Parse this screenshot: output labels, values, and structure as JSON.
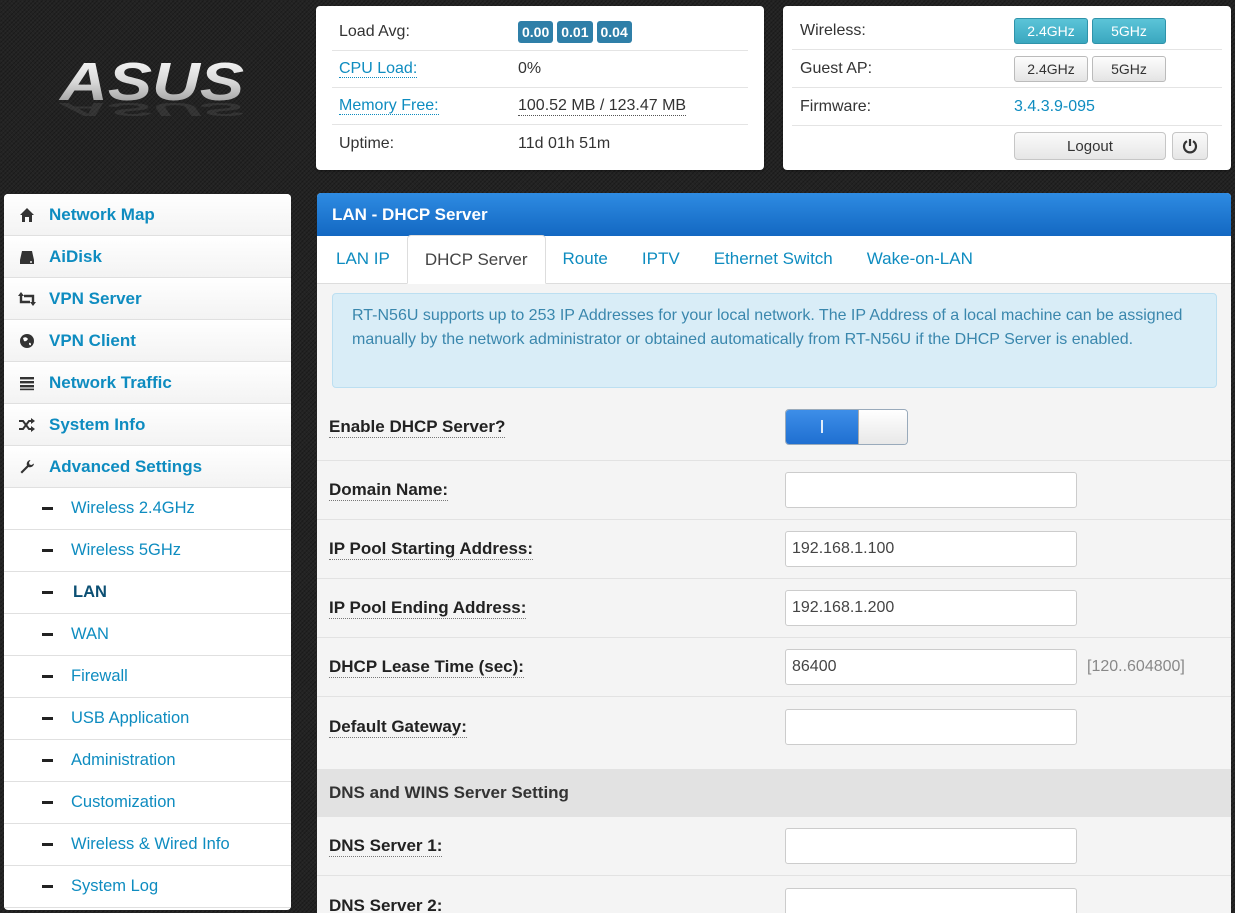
{
  "brand": {
    "logo_text": "ASUS"
  },
  "status": {
    "load_avg_label": "Load Avg:",
    "load_avg_values": [
      "0.00",
      "0.01",
      "0.04"
    ],
    "cpu_label": "CPU Load:",
    "cpu_value": "0%",
    "memory_label": "Memory Free:",
    "memory_value": "100.52 MB / 123.47 MB",
    "uptime_label": "Uptime:",
    "uptime_value": "11d 01h 51m"
  },
  "radio": {
    "wireless_label": "Wireless:",
    "wireless_24": "2.4GHz",
    "wireless_5": "5GHz",
    "guest_label": "Guest AP:",
    "guest_24": "2.4GHz",
    "guest_5": "5GHz",
    "firmware_label": "Firmware:",
    "firmware_value": "3.4.3.9-095",
    "logout_label": "Logout"
  },
  "sidebar": {
    "items": [
      {
        "label": "Network Map",
        "icon": "home-icon"
      },
      {
        "label": "AiDisk",
        "icon": "disk-icon"
      },
      {
        "label": "VPN Server",
        "icon": "vpn-server-icon"
      },
      {
        "label": "VPN Client",
        "icon": "globe-icon"
      },
      {
        "label": "Network Traffic",
        "icon": "list-icon"
      },
      {
        "label": "System Info",
        "icon": "shuffle-icon"
      },
      {
        "label": "Advanced Settings",
        "icon": "wrench-icon"
      }
    ],
    "subitems": [
      "Wireless 2.4GHz",
      "Wireless 5GHz",
      "LAN",
      "WAN",
      "Firewall",
      "USB Application",
      "Administration",
      "Customization",
      "Wireless & Wired Info",
      "System Log"
    ],
    "current": "LAN"
  },
  "main": {
    "title": "LAN - DHCP Server",
    "tabs": [
      "LAN IP",
      "DHCP Server",
      "Route",
      "IPTV",
      "Ethernet Switch",
      "Wake-on-LAN"
    ],
    "active_tab": "DHCP Server",
    "info": "RT-N56U supports up to 253 IP Addresses for your local network. The IP Address of a local machine can be assigned manually by the network administrator or obtained automatically from RT-N56U if the DHCP Server is enabled.",
    "enable_label": "Enable DHCP Server?",
    "enable_on_glyph": "I",
    "enable_state": "on",
    "domain_label": "Domain Name:",
    "domain_value": "",
    "pool_start_label": "IP Pool Starting Address:",
    "pool_start_value": "192.168.1.100",
    "pool_end_label": "IP Pool Ending Address:",
    "pool_end_value": "192.168.1.200",
    "lease_label": "DHCP Lease Time (sec):",
    "lease_value": "86400",
    "lease_hint": "[120..604800]",
    "gateway_label": "Default Gateway:",
    "gateway_value": "",
    "dns_section": "DNS and WINS Server Setting",
    "dns1_label": "DNS Server 1:",
    "dns1_value": "",
    "dns2_label": "DNS Server 2:",
    "dns2_value": ""
  },
  "colors": {
    "accent": "#0e8cc0",
    "header_blue": "#1f76d0",
    "badge": "#2f7fa8",
    "info_bg": "#d9edf7",
    "info_text": "#3a87ad"
  }
}
